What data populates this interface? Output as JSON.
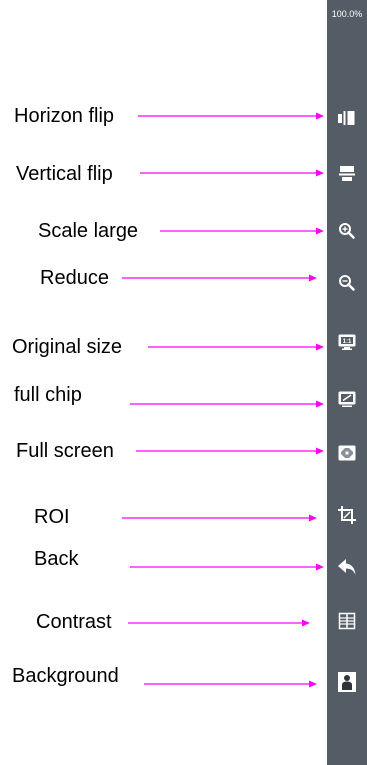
{
  "toolbar": {
    "zoom_level": "100.0%",
    "buttons": [
      {
        "icon": "horizontal-flip-icon",
        "label": "Horizon flip"
      },
      {
        "icon": "vertical-flip-icon",
        "label": "Vertical flip"
      },
      {
        "icon": "zoom-in-icon",
        "label": "Scale large"
      },
      {
        "icon": "zoom-out-icon",
        "label": "Reduce"
      },
      {
        "icon": "original-size-icon",
        "label": "Original size"
      },
      {
        "icon": "full-chip-icon",
        "label": "full chip"
      },
      {
        "icon": "full-screen-icon",
        "label": "Full screen"
      },
      {
        "icon": "roi-crop-icon",
        "label": "ROI"
      },
      {
        "icon": "back-arrow-icon",
        "label": "Back"
      },
      {
        "icon": "contrast-icon",
        "label": "Contrast"
      },
      {
        "icon": "background-person-icon",
        "label": "Background"
      }
    ]
  },
  "colors": {
    "toolbar_background": "#545c66",
    "arrow": "#ff00ff",
    "icon": "#ffffff",
    "label_text": "#000000"
  }
}
